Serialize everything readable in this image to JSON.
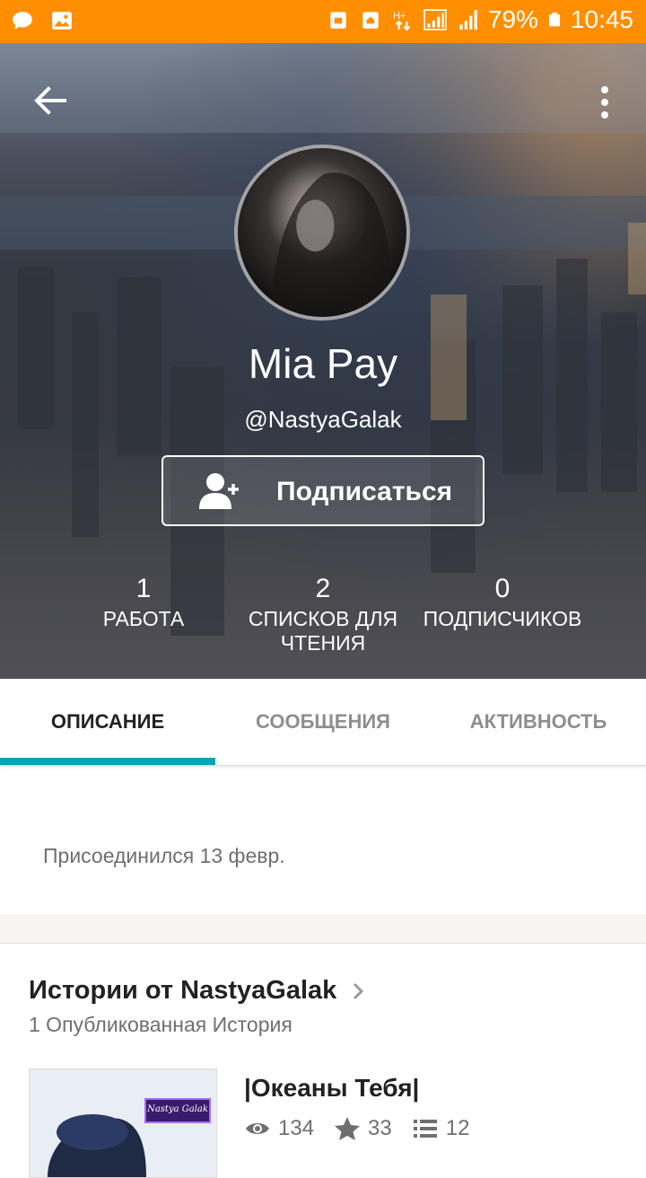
{
  "status_bar": {
    "battery": "79%",
    "time": "10:45",
    "icons": [
      "chat-bubble-icon",
      "image-icon",
      "android-icon",
      "home-icon",
      "data-icon",
      "signal-icon",
      "signal-icon",
      "battery-icon"
    ]
  },
  "profile": {
    "name": "Mia Pay",
    "handle": "@NastyaGalak",
    "follow_label": "Подписаться"
  },
  "stats": [
    {
      "value": "1",
      "label_line1": "РАБОТА",
      "label_line2": ""
    },
    {
      "value": "2",
      "label_line1": "СПИСКОВ ДЛЯ",
      "label_line2": "ЧТЕНИЯ"
    },
    {
      "value": "0",
      "label_line1": "ПОДПИСЧИКОВ",
      "label_line2": ""
    }
  ],
  "tabs": [
    {
      "label": "ОПИСАНИЕ",
      "active": true
    },
    {
      "label": "СООБЩЕНИЯ",
      "active": false
    },
    {
      "label": "АКТИВНОСТЬ",
      "active": false
    }
  ],
  "about": {
    "joined": "Присоединился 13 февр."
  },
  "stories": {
    "title": "Истории от NastyaGalak",
    "subtitle": "1 Опубликованная История",
    "items": [
      {
        "title": "|Океаны Тебя|",
        "views": "134",
        "votes": "33",
        "parts": "12",
        "cover_tag": "Nastya Galak"
      }
    ]
  },
  "colors": {
    "status_bar": "#ff8f00",
    "tab_indicator": "#00a4b5"
  }
}
